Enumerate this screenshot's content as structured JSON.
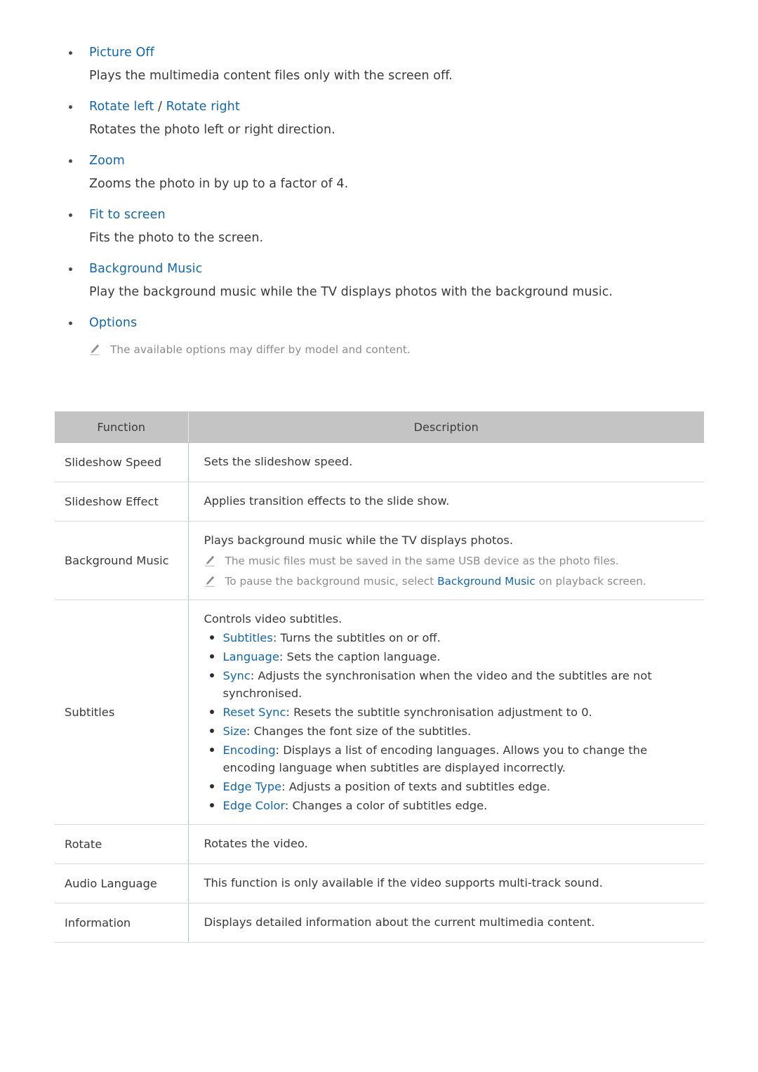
{
  "sections": [
    {
      "title": "Picture Off",
      "title_parts": [
        {
          "text": "Picture Off",
          "style": "link"
        }
      ],
      "body": "Plays the multimedia content files only with the screen off."
    },
    {
      "title": "Rotate left / Rotate right",
      "title_parts": [
        {
          "text": "Rotate left",
          "style": "link"
        },
        {
          "text": " / ",
          "style": "plain"
        },
        {
          "text": "Rotate right",
          "style": "link"
        }
      ],
      "body": "Rotates the photo left or right direction."
    },
    {
      "title": "Zoom",
      "title_parts": [
        {
          "text": "Zoom",
          "style": "link"
        }
      ],
      "body": "Zooms the photo in by up to a factor of 4."
    },
    {
      "title": "Fit to screen",
      "title_parts": [
        {
          "text": "Fit to screen",
          "style": "link"
        }
      ],
      "body": "Fits the photo to the screen."
    },
    {
      "title": "Background Music",
      "title_parts": [
        {
          "text": "Background Music",
          "style": "link"
        }
      ],
      "body": "Play the background music while the TV displays photos with the background music."
    },
    {
      "title": "Options",
      "title_parts": [
        {
          "text": "Options",
          "style": "link"
        }
      ],
      "body": "",
      "note": "The available options may differ by model and content."
    }
  ],
  "table": {
    "headers": [
      "Function",
      "Description"
    ],
    "rows": [
      {
        "function": "Slideshow Speed",
        "lead": "Sets the slideshow speed.",
        "notes": [],
        "bullets": []
      },
      {
        "function": "Slideshow Effect",
        "lead": "Applies transition effects to the slide show.",
        "notes": [],
        "bullets": []
      },
      {
        "function": "Background Music",
        "lead": "Plays background music while the TV displays photos.",
        "notes": [
          {
            "parts": [
              {
                "text": "The music files must be saved in the same USB device as the photo files.",
                "style": "plain"
              }
            ]
          },
          {
            "parts": [
              {
                "text": "To pause the background music, select ",
                "style": "plain"
              },
              {
                "text": "Background Music",
                "style": "link"
              },
              {
                "text": " on playback screen.",
                "style": "plain"
              }
            ]
          }
        ],
        "bullets": []
      },
      {
        "function": "Subtitles",
        "lead": "Controls video subtitles.",
        "notes": [],
        "bullets": [
          {
            "term": "Subtitles",
            "rest": ": Turns the subtitles on or off."
          },
          {
            "term": "Language",
            "rest": ": Sets the caption language."
          },
          {
            "term": "Sync",
            "rest": ": Adjusts the synchronisation when the video and the subtitles are not synchronised."
          },
          {
            "term": "Reset Sync",
            "rest": ": Resets the subtitle synchronisation adjustment to 0."
          },
          {
            "term": "Size",
            "rest": ": Changes the font size of the subtitles."
          },
          {
            "term": "Encoding",
            "rest": ": Displays a list of encoding languages. Allows you to change the encoding language when subtitles are displayed incorrectly."
          },
          {
            "term": "Edge Type",
            "rest": ": Adjusts a position of texts and subtitles edge."
          },
          {
            "term": "Edge Color",
            "rest": ": Changes a color of subtitles edge."
          }
        ]
      },
      {
        "function": "Rotate",
        "lead": "Rotates the video.",
        "notes": [],
        "bullets": []
      },
      {
        "function": "Audio Language",
        "lead": "This function is only available if the video supports multi-track sound.",
        "notes": [],
        "bullets": []
      },
      {
        "function": "Information",
        "lead": "Displays detailed information about the current multimedia content.",
        "notes": [],
        "bullets": []
      }
    ]
  },
  "colors": {
    "link": "#1267ad",
    "text": "#3a3a3a",
    "note": "#8c8c8c",
    "table_header_bg": "#c4c4c4",
    "row_border": "#d8d8d8",
    "col_border": "#b9bfd8"
  }
}
